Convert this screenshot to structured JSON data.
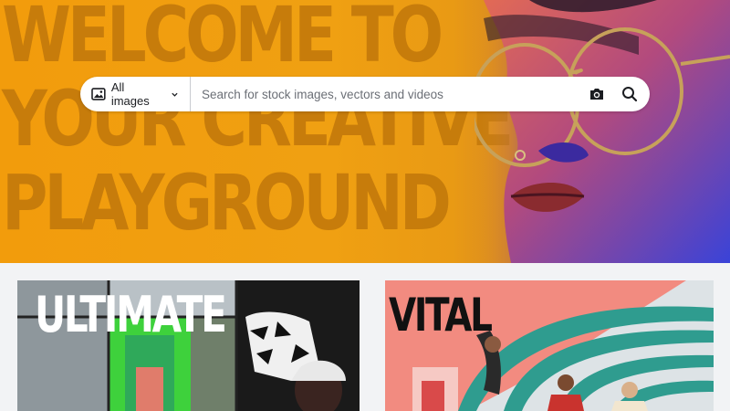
{
  "hero": {
    "headline_lines": [
      "WELCOME TO",
      "YOUR CREATIVE",
      "PLAYGROUND"
    ]
  },
  "search": {
    "type_label": "All images",
    "placeholder": "Search for stock images, vectors and videos",
    "icons": {
      "type": "image-icon",
      "dropdown": "chevron-down-icon",
      "camera": "camera-icon",
      "search": "search-icon"
    }
  },
  "collections": [
    {
      "title": "ULTIMATE"
    },
    {
      "title": "VITAL"
    }
  ],
  "colors": {
    "hero_orange": "#f29c0c",
    "headline_orange": "#c47a0b",
    "coral": "#f08a82",
    "teal": "#2f9c8f",
    "neon_green": "#35e63c"
  }
}
